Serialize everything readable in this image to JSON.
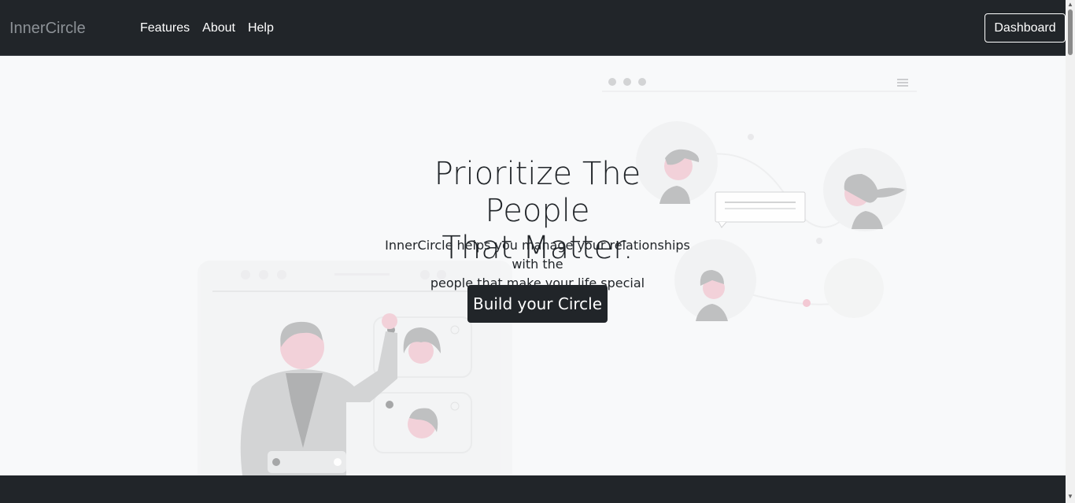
{
  "navbar": {
    "brand": "InnerCircle",
    "links": [
      "Features",
      "About",
      "Help"
    ],
    "dashboard_label": "Dashboard"
  },
  "hero": {
    "title_line1": "Prioritize The People",
    "title_line2": "That Matter.",
    "subtitle_line1": "InnerCircle helps you manage your relationships with the",
    "subtitle_line2": "people that make your life special",
    "cta_label": "Build your Circle"
  },
  "colors": {
    "navbar_bg": "#212529",
    "page_bg": "#f8f9fa",
    "accent_pink": "#e8a0b0"
  }
}
